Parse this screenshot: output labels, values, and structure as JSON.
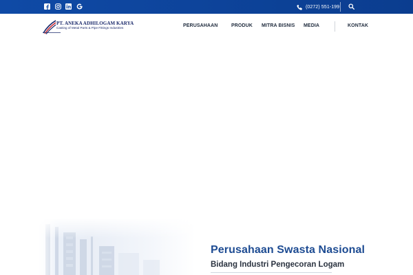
{
  "topbar": {
    "social_icons": [
      {
        "name": "facebook-icon",
        "glyph": "f"
      },
      {
        "name": "instagram-icon",
        "glyph": "ig"
      },
      {
        "name": "linkedin-icon",
        "glyph": "in"
      },
      {
        "name": "google-icon",
        "glyph": "G"
      }
    ],
    "phone_icon": "phone-icon",
    "phone": "(0272) 551-199",
    "search_icon": "search-icon"
  },
  "header": {
    "logo": {
      "name": "PT. ANEKA ADHILOGAM KARYA",
      "tagline": "Casting of Metal Parts & Pipe Fittings Industries"
    },
    "nav": [
      "PERUSAHAAN",
      "PRODUK",
      "MITRA BISNIS",
      "MEDIA",
      "KONTAK"
    ]
  },
  "hero": {
    "title": "Perusahaan Swasta Nasional",
    "subtitle": "Bidang Industri Pengecoran Logam"
  },
  "colors": {
    "topbar": "#0f4aa6",
    "brand_navy": "#1b2a6b",
    "hero_title": "#1d4b92",
    "nav_text": "#1f2b3d"
  }
}
